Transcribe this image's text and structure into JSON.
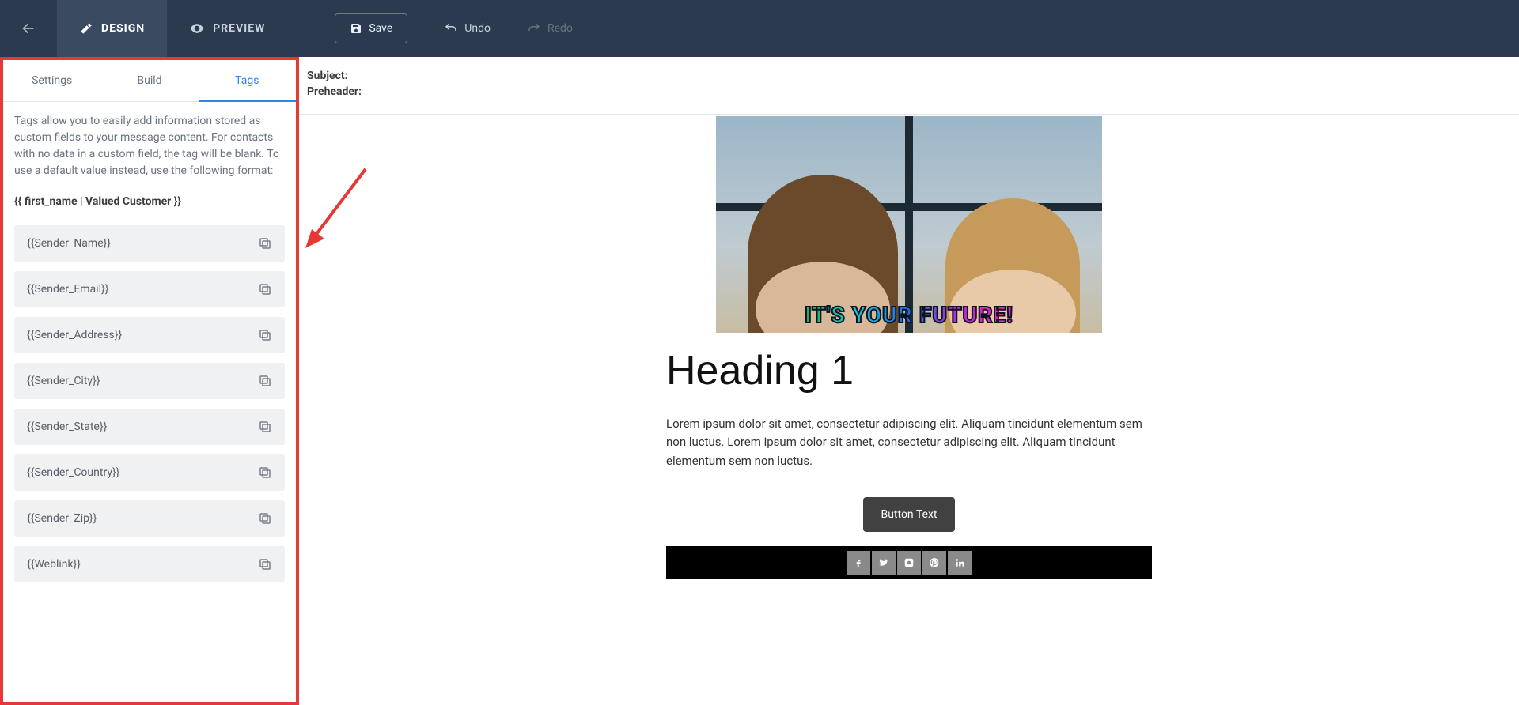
{
  "topbar": {
    "design": "DESIGN",
    "preview": "PREVIEW",
    "save": "Save",
    "undo": "Undo",
    "redo": "Redo"
  },
  "sidebar": {
    "tabs": {
      "settings": "Settings",
      "build": "Build",
      "tags": "Tags"
    },
    "description": "Tags allow you to easily add information stored as custom fields to your message content. For contacts with no data in a custom field, the tag will be blank. To use a default value instead, use the following format:",
    "example": "{{ first_name | Valued Customer }}",
    "items": [
      "{{Sender_Name}}",
      "{{Sender_Email}}",
      "{{Sender_Address}}",
      "{{Sender_City}}",
      "{{Sender_State}}",
      "{{Sender_Country}}",
      "{{Sender_Zip}}",
      "{{Weblink}}"
    ]
  },
  "canvas": {
    "subject_label": "Subject:",
    "preheader_label": "Preheader:",
    "hero_caption": "IT'S YOUR FUTURE!",
    "heading": "Heading 1",
    "body": "Lorem ipsum dolor sit amet, consectetur adipiscing elit. Aliquam tincidunt elementum sem non luctus. Lorem ipsum dolor sit amet, consectetur adipiscing elit. Aliquam tincidunt elementum sem non luctus.",
    "button": "Button Text"
  }
}
